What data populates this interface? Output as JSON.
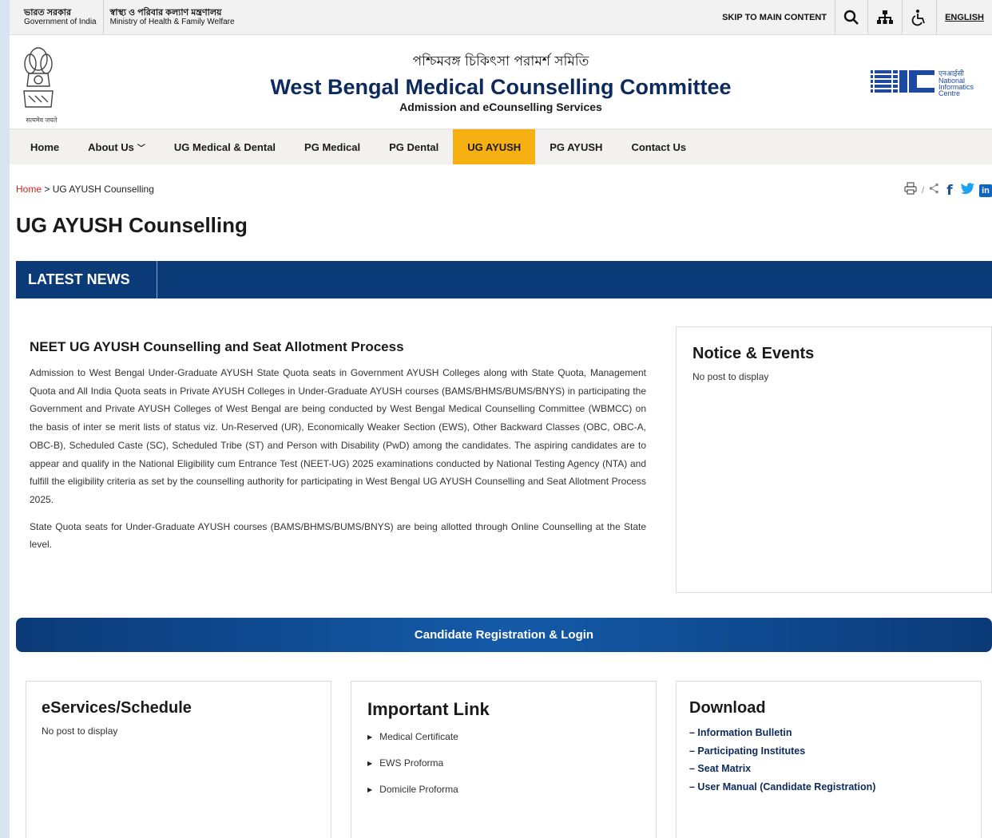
{
  "gov_bar": {
    "gov_hi": "ভারত সরকার",
    "gov_en": "Government of India",
    "ministry_hi": "স্বাস্থ্য ও পরিবার কল্যাণ মন্ত্রণালয়",
    "ministry_en": "Ministry of Health & Family Welfare",
    "skip_label": "SKIP TO MAIN CONTENT",
    "icons": [
      "search-icon",
      "sitemap-icon",
      "accessibility-icon"
    ],
    "language": "ENGLISH"
  },
  "header": {
    "title_bn": "পশ্চিমবঙ্গ চিকিৎসা পরামর্শ সমিতি",
    "title_en": "West Bengal Medical Counselling Committee",
    "subtitle": "Admission and eCounselling Services",
    "emblem_caption": "सत्यमेव जयते",
    "nic_hi": "एनआईसी",
    "nic_line1": "National",
    "nic_line2": "Informatics",
    "nic_line3": "Centre",
    "nic_mark": "NIC"
  },
  "nav": {
    "items": [
      "Home",
      "About Us",
      "UG Medical & Dental",
      "PG Medical",
      "PG Dental",
      "UG AYUSH",
      "PG AYUSH",
      "Contact Us"
    ],
    "active": "UG AYUSH",
    "caret": "﹀"
  },
  "breadcrumb": {
    "home": "Home",
    "separator": " > ",
    "current": "UG AYUSH Counselling"
  },
  "share": {
    "icons": [
      "print-icon",
      "share-icon",
      "facebook-icon",
      "twitter-icon",
      "linkedin-icon"
    ],
    "facebook": "f",
    "twitter": "t",
    "linkedin": "in",
    "divider": "/"
  },
  "page_title": "UG AYUSH Counselling",
  "latest_news": "LATEST NEWS",
  "article": {
    "heading": "NEET UG AYUSH Counselling and Seat Allotment Process",
    "para1": "Admission to West Bengal Under-Graduate AYUSH State Quota seats in Government AYUSH Colleges along with State Quota, Management Quota and All India Quota seats in Private AYUSH Colleges in Under-Graduate AYUSH courses (BAMS/BHMS/BUMS/BNYS) in participating the Government and Private AYUSH Colleges of West Bengal are being conducted by West Bengal Medical Counselling Committee (WBMCC) on the basis of inter se merit lists of status viz. Un-Reserved (UR), Economically Weaker Section (EWS), Other Backward Classes (OBC, OBC-A, OBC-B), Scheduled Caste (SC), Scheduled Tribe (ST) and Person with Disability (PwD) among the candidates. The aspiring candidates are to appear and qualify in the National Eligibility cum Entrance Test (NEET-UG) 2025 examinations conducted by National Testing Agency (NTA) and fulfill the eligibility criteria as set by the counselling authority for participating in West Bengal UG AYUSH Counselling and Seat Allotment Process 2025.",
    "para2": "State Quota seats for Under-Graduate AYUSH courses (BAMS/BHMS/BUMS/BNYS) are being allotted through Online Counselling at the State level."
  },
  "notice": {
    "title": "Notice & Events",
    "empty": "No post to display"
  },
  "registration": "Candidate Registration & Login",
  "eservices": {
    "title": "eServices/Schedule",
    "empty": "No post to display"
  },
  "important_link": {
    "title": "Important Link",
    "links": [
      "Medical Certificate",
      "EWS Proforma",
      "Domicile Proforma"
    ]
  },
  "download": {
    "title": "Download",
    "links": [
      "– Information Bulletin",
      "– Participating Institutes",
      "– Seat Matrix",
      "– User Manual (Candidate Registration)"
    ]
  },
  "colors": {
    "navy": "#0b3a78",
    "active_tab": "#f6b012",
    "breadcrumb_home": "#d4211c",
    "facebook": "#1d4f9c",
    "twitter": "#1da1f2",
    "linkedin": "#0a66c2"
  }
}
